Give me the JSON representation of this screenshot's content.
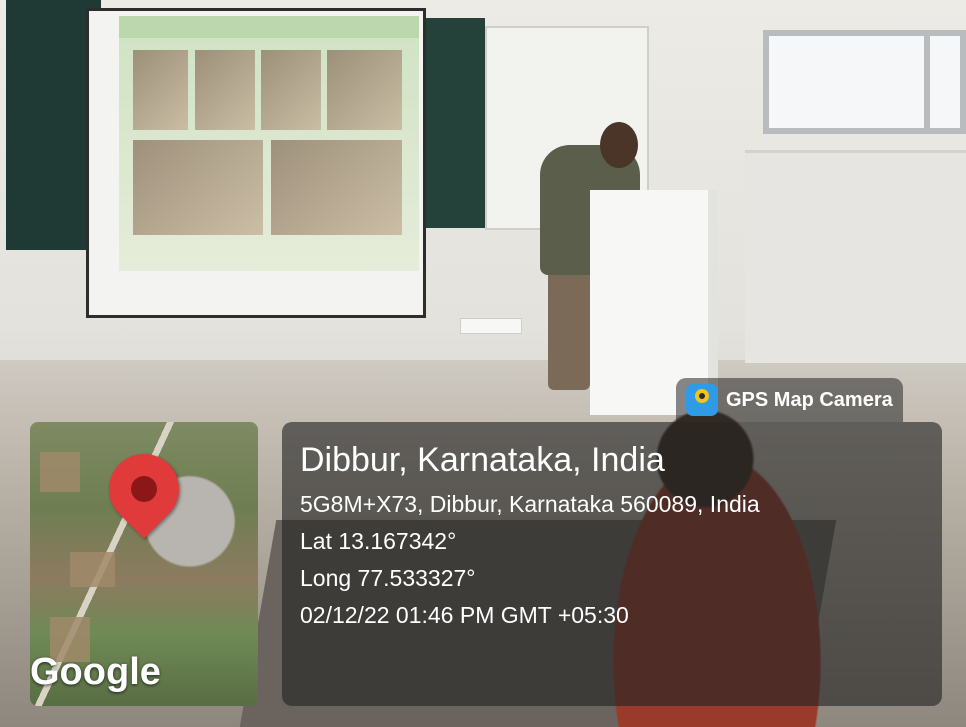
{
  "overlay": {
    "app_badge": {
      "label": "GPS Map Camera",
      "icon": "gps-map-camera-logo-icon"
    },
    "map": {
      "brand": "Google",
      "pin_icon": "location-pin-icon"
    },
    "location": {
      "place": "Dibbur, Karnataka, India",
      "address": "5G8M+X73, Dibbur, Karnataka 560089, India",
      "latitude": "Lat 13.167342°",
      "longitude": "Long 77.533327°",
      "timestamp": "02/12/22 01:46 PM GMT +05:30"
    },
    "colors": {
      "pin": "#e03a3a",
      "panel": "#232323",
      "text": "#ffffff"
    }
  }
}
